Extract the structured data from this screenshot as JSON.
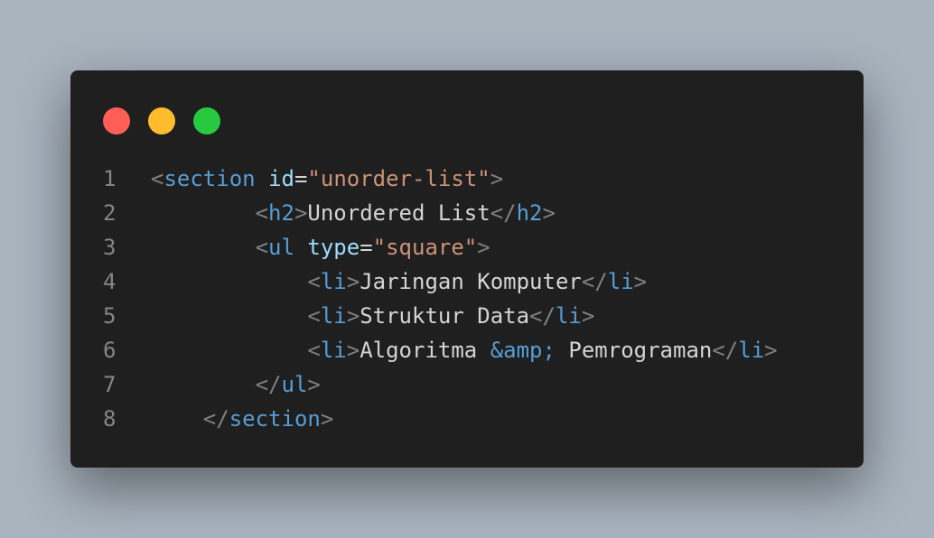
{
  "colors": {
    "background": "#a9b4bf",
    "editor": "#1f1f1f",
    "dot_red": "#ff5f56",
    "dot_yellow": "#ffbd2e",
    "dot_green": "#27c93f"
  },
  "window_controls": [
    "close-dot",
    "minimize-dot",
    "maximize-dot"
  ],
  "lines": [
    {
      "number": "1",
      "indent": "",
      "tokens": [
        {
          "t": "pun",
          "v": "<"
        },
        {
          "t": "tag",
          "v": "section"
        },
        {
          "t": "txt",
          "v": " "
        },
        {
          "t": "attr",
          "v": "id"
        },
        {
          "t": "eq",
          "v": "="
        },
        {
          "t": "str",
          "v": "\"unorder-list\""
        },
        {
          "t": "pun",
          "v": ">"
        }
      ]
    },
    {
      "number": "2",
      "indent": "        ",
      "tokens": [
        {
          "t": "pun",
          "v": "<"
        },
        {
          "t": "tag",
          "v": "h2"
        },
        {
          "t": "pun",
          "v": ">"
        },
        {
          "t": "txt",
          "v": "Unordered List"
        },
        {
          "t": "pun",
          "v": "</"
        },
        {
          "t": "tag",
          "v": "h2"
        },
        {
          "t": "pun",
          "v": ">"
        }
      ]
    },
    {
      "number": "3",
      "indent": "        ",
      "tokens": [
        {
          "t": "pun",
          "v": "<"
        },
        {
          "t": "tag",
          "v": "ul"
        },
        {
          "t": "txt",
          "v": " "
        },
        {
          "t": "attr",
          "v": "type"
        },
        {
          "t": "eq",
          "v": "="
        },
        {
          "t": "str",
          "v": "\"square\""
        },
        {
          "t": "pun",
          "v": ">"
        }
      ]
    },
    {
      "number": "4",
      "indent": "            ",
      "tokens": [
        {
          "t": "pun",
          "v": "<"
        },
        {
          "t": "tag",
          "v": "li"
        },
        {
          "t": "pun",
          "v": ">"
        },
        {
          "t": "txt",
          "v": "Jaringan Komputer"
        },
        {
          "t": "pun",
          "v": "</"
        },
        {
          "t": "tag",
          "v": "li"
        },
        {
          "t": "pun",
          "v": ">"
        }
      ]
    },
    {
      "number": "5",
      "indent": "            ",
      "tokens": [
        {
          "t": "pun",
          "v": "<"
        },
        {
          "t": "tag",
          "v": "li"
        },
        {
          "t": "pun",
          "v": ">"
        },
        {
          "t": "txt",
          "v": "Struktur Data"
        },
        {
          "t": "pun",
          "v": "</"
        },
        {
          "t": "tag",
          "v": "li"
        },
        {
          "t": "pun",
          "v": ">"
        }
      ]
    },
    {
      "number": "6",
      "indent": "            ",
      "tokens": [
        {
          "t": "pun",
          "v": "<"
        },
        {
          "t": "tag",
          "v": "li"
        },
        {
          "t": "pun",
          "v": ">"
        },
        {
          "t": "txt",
          "v": "Algoritma "
        },
        {
          "t": "ent",
          "v": "&amp;"
        },
        {
          "t": "txt",
          "v": " Pemrograman"
        },
        {
          "t": "pun",
          "v": "</"
        },
        {
          "t": "tag",
          "v": "li"
        },
        {
          "t": "pun",
          "v": ">"
        }
      ]
    },
    {
      "number": "7",
      "indent": "        ",
      "tokens": [
        {
          "t": "pun",
          "v": "</"
        },
        {
          "t": "tag",
          "v": "ul"
        },
        {
          "t": "pun",
          "v": ">"
        }
      ]
    },
    {
      "number": "8",
      "indent": "    ",
      "tokens": [
        {
          "t": "pun",
          "v": "</"
        },
        {
          "t": "tag",
          "v": "section"
        },
        {
          "t": "pun",
          "v": ">"
        }
      ]
    }
  ]
}
